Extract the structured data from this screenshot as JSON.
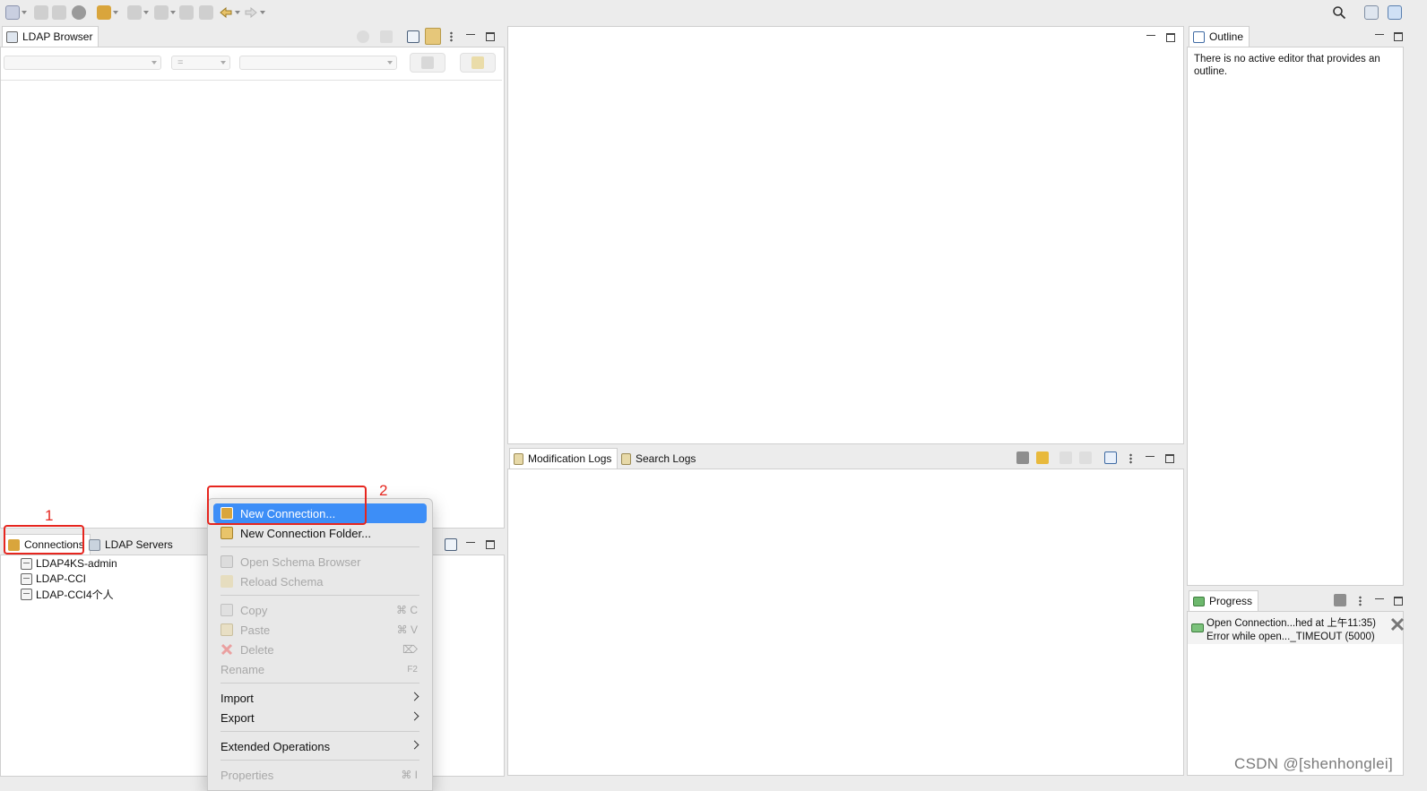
{
  "left_view": {
    "tab_label": "LDAP Browser",
    "filter_operator": "="
  },
  "connections_view": {
    "tabs": [
      {
        "label": "Connections"
      },
      {
        "label": "LDAP Servers"
      }
    ],
    "items": [
      {
        "label": "LDAP4KS-admin"
      },
      {
        "label": "LDAP-CCI"
      },
      {
        "label": "LDAP-CCI4个人"
      }
    ]
  },
  "context_menu": {
    "items": [
      {
        "label": "New Connection...",
        "state": "highlighted",
        "icon": "ldap-new-connection-icon"
      },
      {
        "label": "New Connection Folder...",
        "icon": "folder-open-icon"
      },
      {
        "label": "Open Schema Browser",
        "state": "disabled",
        "icon": "schema-icon"
      },
      {
        "label": "Reload Schema",
        "state": "disabled",
        "icon": "reload-icon"
      },
      {
        "label": "Copy",
        "shortcut": "⌘ C",
        "state": "disabled",
        "icon": "copy-icon"
      },
      {
        "label": "Paste",
        "shortcut": "⌘ V",
        "state": "disabled",
        "icon": "paste-icon"
      },
      {
        "label": "Delete",
        "shortcut": "⌦",
        "state": "disabled",
        "icon": "delete-icon"
      },
      {
        "label": "Rename",
        "shortcut": "F2",
        "state": "disabled"
      },
      {
        "label": "Import",
        "submenu": true
      },
      {
        "label": "Export",
        "submenu": true
      },
      {
        "label": "Extended Operations",
        "submenu": true
      },
      {
        "label": "Properties",
        "shortcut": "⌘ I",
        "state": "disabled"
      }
    ]
  },
  "logs_view": {
    "tabs": [
      {
        "label": "Modification Logs"
      },
      {
        "label": "Search Logs"
      }
    ]
  },
  "outline_view": {
    "tab_label": "Outline",
    "message": "There is no active editor that provides an outline."
  },
  "progress_view": {
    "tab_label": "Progress",
    "entry_title": "Open Connection...hed at 上午11:35)",
    "entry_detail": "Error while open..._TIMEOUT (5000)"
  },
  "annotations": {
    "marker_1": "1",
    "marker_2": "2",
    "color": "#e6261f"
  },
  "watermark": "CSDN @[shenhonglei]",
  "colors": {
    "highlight": "#3d8ef7",
    "annotation_red": "#e6261f",
    "ldap_icon": "#d9a53c"
  }
}
